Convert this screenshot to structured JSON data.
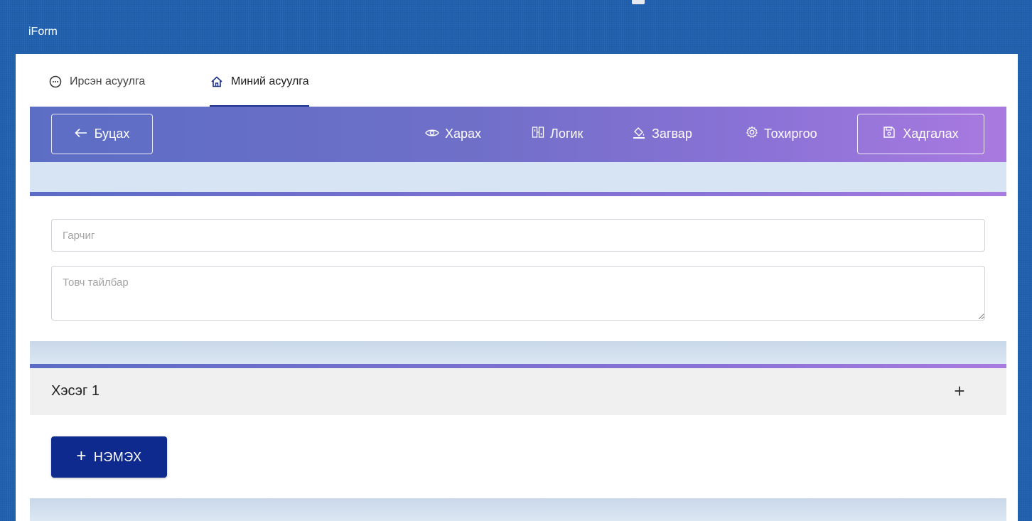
{
  "app": {
    "title": "iForm"
  },
  "tabs": [
    {
      "label": "Ирсэн асуулга",
      "icon": "chat-bubble-icon",
      "active": false
    },
    {
      "label": "Миний асуулга",
      "icon": "home-icon",
      "active": true
    }
  ],
  "toolbar": {
    "back_label": "Буцах",
    "view_label": "Харах",
    "logic_label": "Логик",
    "design_label": "Загвар",
    "settings_label": "Тохиргоо",
    "save_label": "Хадгалах"
  },
  "form": {
    "title_placeholder": "Гарчиг",
    "title_value": "",
    "description_placeholder": "Товч тайлбар",
    "description_value": ""
  },
  "section": {
    "title": "Хэсэг 1",
    "expand_symbol": "+"
  },
  "add_button": {
    "label": "НЭМЭХ",
    "symbol": "+"
  },
  "colors": {
    "window_blue": "#1e5eab",
    "toolbar_gradient_start": "#5c6ec4",
    "toolbar_gradient_end": "#a97ae0",
    "add_button": "#0e2a8f",
    "strip": "#d6e4f3"
  }
}
